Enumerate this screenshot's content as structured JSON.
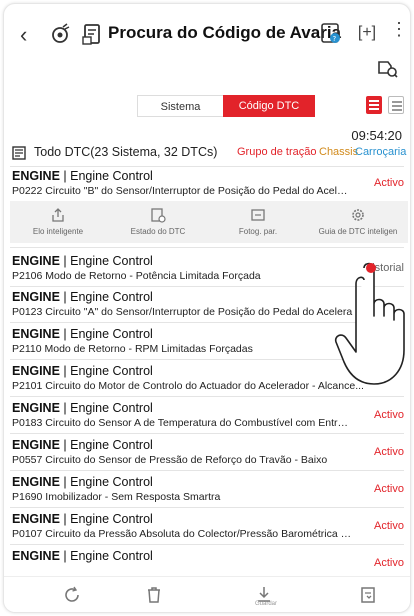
{
  "header": {
    "back_icon": "chevron-left-icon",
    "title": "Procura do Código de Avaria"
  },
  "tabs": [
    {
      "label": "Sistema",
      "selected": false
    },
    {
      "label": "Código DTC",
      "selected": true
    }
  ],
  "colors": {
    "accent": "#e2232a",
    "chassis": "#d18a1b",
    "body": "#2891cf"
  },
  "summary": {
    "time": "09:54:20",
    "text": "Todo DTC(23 Sistema, 32 DTCs)",
    "group_powertrain": "Grupo de tração",
    "group_chassis": "Chassis",
    "group_body": "Carroçaria"
  },
  "rows": [
    {
      "system": "ENGINE",
      "sub": " | Engine Control",
      "desc": "P0222 Circuito \"B\" do Sensor/Interruptor de Posição do Pedal do Acelerad...",
      "status": "Activo"
    },
    {
      "system": "ENGINE",
      "sub": " | Engine Control",
      "desc": "P2106 Modo de Retorno - Potência Limitada Forçada",
      "status": "Historial"
    },
    {
      "system": "ENGINE",
      "sub": " | Engine Control",
      "desc": "P0123 Circuito \"A\" do Sensor/Interruptor de Posição do Pedal do Acelera",
      "status": ""
    },
    {
      "system": "ENGINE",
      "sub": " | Engine Control",
      "desc": "P2110 Modo de Retorno - RPM Limitadas Forçadas",
      "status": ""
    },
    {
      "system": "ENGINE",
      "sub": " | Engine Control",
      "desc": "P2101 Circuito do Motor de Controlo do Actuador do Acelerador - Alcance...",
      "status": ""
    },
    {
      "system": "ENGINE",
      "sub": " | Engine Control",
      "desc": "P0183 Circuito do Sensor A de Temperatura do Combustível com Entrada...",
      "status": "Activo"
    },
    {
      "system": "ENGINE",
      "sub": " | Engine Control",
      "desc": "P0557 Circuito do Sensor de Pressão de Reforço do Travão - Baixo",
      "status": "Activo"
    },
    {
      "system": "ENGINE",
      "sub": " | Engine Control",
      "desc": "P1690 Imobilizador - Sem Resposta Smartra",
      "status": "Activo"
    },
    {
      "system": "ENGINE",
      "sub": " | Engine Control",
      "desc": "P0107 Circuito da Pressão Absoluta do Colector/Pressão Barométrica com...",
      "status": "Activo"
    },
    {
      "system": "ENGINE",
      "sub": " | Engine Control",
      "desc": "",
      "status": "Activo"
    }
  ],
  "actions": [
    {
      "label": "Elo inteligente",
      "icon": "share-icon"
    },
    {
      "label": "Estado do DTC",
      "icon": "dtc-status-icon"
    },
    {
      "label": "Fotog. par.",
      "icon": "freeze-frame-icon"
    },
    {
      "label": "Guia de DTC inteligen",
      "icon": "gear-icon"
    }
  ],
  "bottom": [
    {
      "icon": "refresh-icon"
    },
    {
      "icon": "delete-icon"
    },
    {
      "icon": "save-icon",
      "label": "Guardar"
    },
    {
      "icon": "report-icon"
    }
  ]
}
